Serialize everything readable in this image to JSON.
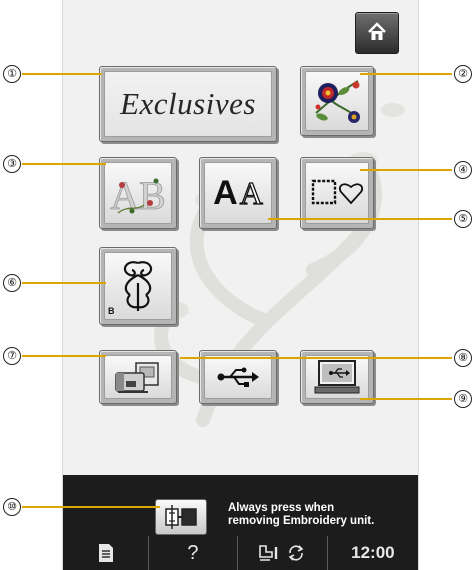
{
  "screen": {
    "home_icon": "home-icon",
    "buttons": [
      {
        "id": "exclusives",
        "label": "Exclusives"
      },
      {
        "id": "embroidery-patterns",
        "icon": "floral-embroidery-icon"
      },
      {
        "id": "floral-alphabet",
        "icon": "floral-alphabet-icon",
        "text": "AB"
      },
      {
        "id": "character-patterns",
        "icon": "font-letters-icon",
        "text_a": "A",
        "text_b": "A"
      },
      {
        "id": "frame-patterns",
        "icon": "frame-heart-icon"
      },
      {
        "id": "utility-embroidery",
        "icon": "scroll-motif-icon",
        "tag": "B"
      },
      {
        "id": "machine-memory",
        "icon": "machine-memory-icon"
      },
      {
        "id": "usb-media",
        "icon": "usb-icon"
      },
      {
        "id": "computer-usb",
        "icon": "computer-usb-icon"
      }
    ],
    "embroidery_unit_notice": {
      "icon": "embroidery-unit-icon",
      "line1": "Always press when",
      "line2": "removing Embroidery unit."
    },
    "status_bar": {
      "manual_icon": "manual-page-icon",
      "help_label": "?",
      "presser_icon": "presser-foot-icon",
      "rotate_icon": "rotate-arrows-icon",
      "clock": "12:00"
    },
    "colors": {
      "screen_background": "#f1f1f1",
      "bottom_bar": "#1c1c1c",
      "callout_line": "#dca600"
    }
  },
  "callouts": [
    "①",
    "②",
    "③",
    "④",
    "⑤",
    "⑥",
    "⑦",
    "⑧",
    "⑨",
    "⑩"
  ]
}
